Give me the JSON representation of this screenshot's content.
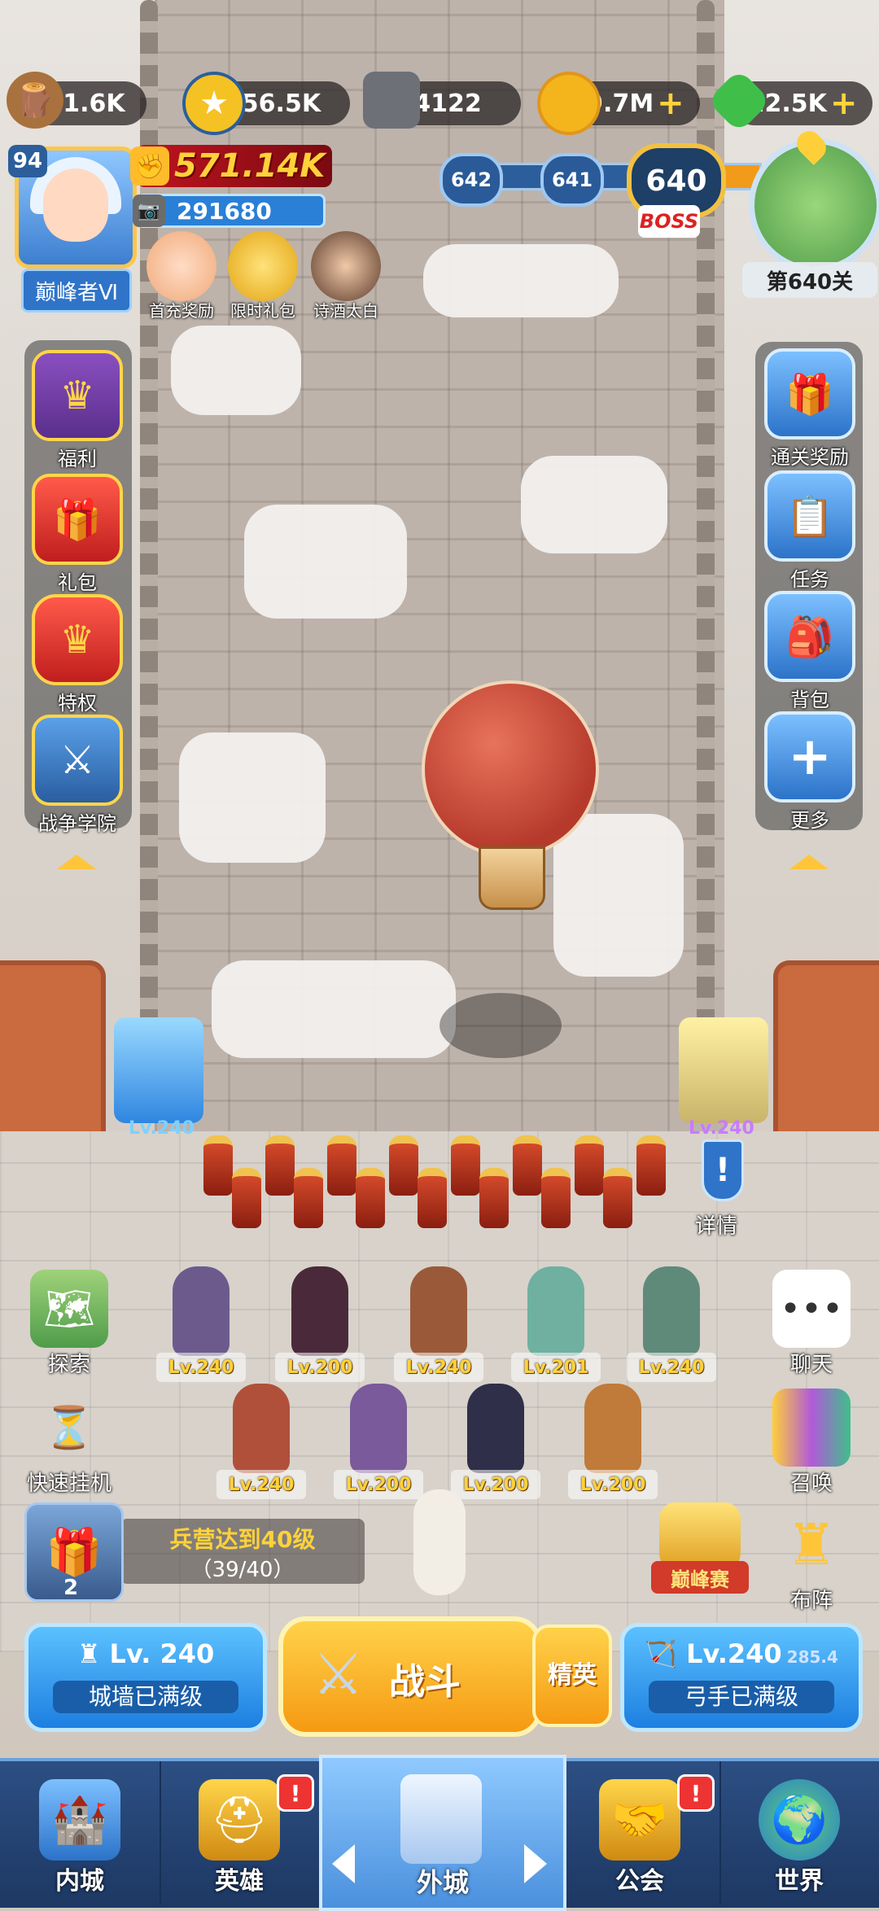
{
  "resources": {
    "wood": "61.6K",
    "gold_star": "256.5K",
    "iron": "4122",
    "coins": "19.7M",
    "gems": "22.5K",
    "plus": "+"
  },
  "player": {
    "level": "94",
    "rank": "巅峰者Ⅵ",
    "power": "571.14K",
    "sub_power": "291680"
  },
  "quick_links": [
    {
      "label": "首充奖励"
    },
    {
      "label": "限时礼包"
    },
    {
      "label": "诗酒太白"
    }
  ],
  "stage": {
    "prev2": "642",
    "prev1": "641",
    "current": "640",
    "boss": "BOSS",
    "label": "第640关"
  },
  "left_menu": [
    {
      "label": "福利"
    },
    {
      "label": "礼包"
    },
    {
      "label": "特权"
    },
    {
      "label": "战争学院"
    }
  ],
  "right_menu": [
    {
      "label": "通关奖励"
    },
    {
      "label": "任务"
    },
    {
      "label": "背包"
    },
    {
      "label": "更多"
    }
  ],
  "towers": {
    "left_lv": "Lv.240",
    "right_lv": "Lv.240"
  },
  "details_label": "详情",
  "details_mark": "!",
  "heroes": [
    {
      "lv": "Lv.240",
      "color": "#6c5a8c"
    },
    {
      "lv": "Lv.200",
      "color": "#4a2a3a"
    },
    {
      "lv": "Lv.240",
      "color": "#9a5a3a"
    },
    {
      "lv": "Lv.201",
      "color": "#6fb0a0"
    },
    {
      "lv": "Lv.240",
      "color": "#5f8a7a"
    },
    {
      "lv": "Lv.240",
      "color": "#b0503a"
    },
    {
      "lv": "Lv.200",
      "color": "#7a5a9a"
    },
    {
      "lv": "Lv.200",
      "color": "#2f2f4a"
    },
    {
      "lv": "Lv.200",
      "color": "#c07a3a"
    }
  ],
  "left_buttons": [
    {
      "label": "探索"
    },
    {
      "label": "快速挂机"
    }
  ],
  "right_buttons": [
    {
      "label": "聊天"
    },
    {
      "label": "召唤"
    },
    {
      "label": "布阵"
    }
  ],
  "quest": {
    "title": "兵营达到40级",
    "progress": "（39/40）",
    "count": "2"
  },
  "peak_label": "巅峰赛",
  "actions": {
    "wall_lv": "Lv. 240",
    "wall_status": "城墙已满级",
    "battle": "战斗",
    "elite": "精英",
    "archer_lv": "Lv.240",
    "archer_extra": "285.4",
    "archer_status": "弓手已满级"
  },
  "nav": [
    {
      "label": "内城"
    },
    {
      "label": "英雄"
    },
    {
      "label": "外城"
    },
    {
      "label": "公会"
    },
    {
      "label": "世界"
    }
  ],
  "badge_mark": "!"
}
